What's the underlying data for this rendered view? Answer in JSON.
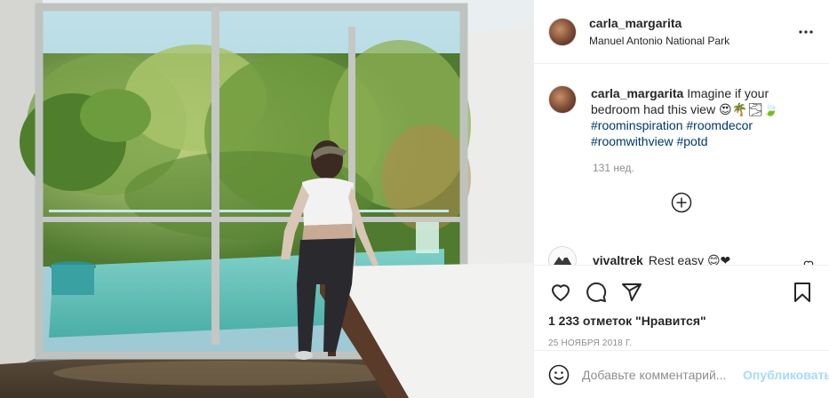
{
  "post": {
    "author": "carla_margarita",
    "location": "Manuel Antonio National Park",
    "caption_text": "Imagine if your bedroom had this view 😍🌴🌫🍃",
    "hashtags": [
      "#roominspiration",
      "#roomdecor",
      "#roomwithview",
      "#potd"
    ],
    "age": "131 нед.",
    "likes": "1 233 отметок \"Нравится\"",
    "date": "25 ноября 2018 г."
  },
  "comments": [
    {
      "author": "vivaltrek",
      "text": "Rest easy 😊❤"
    }
  ],
  "add_comment": {
    "placeholder": "Добавьте комментарий...",
    "post_label": "Опубликовать"
  },
  "icons": {
    "more": "more-horizontal-icon",
    "load_more": "plus-circle-icon",
    "like": "heart-icon",
    "comment": "comment-icon",
    "share": "share-icon",
    "save": "bookmark-icon",
    "emoji": "emoji-icon"
  },
  "colors": {
    "link": "#00376b",
    "meta": "#8e8e8e",
    "post_button": "#0095f6",
    "border": "#efefef"
  }
}
